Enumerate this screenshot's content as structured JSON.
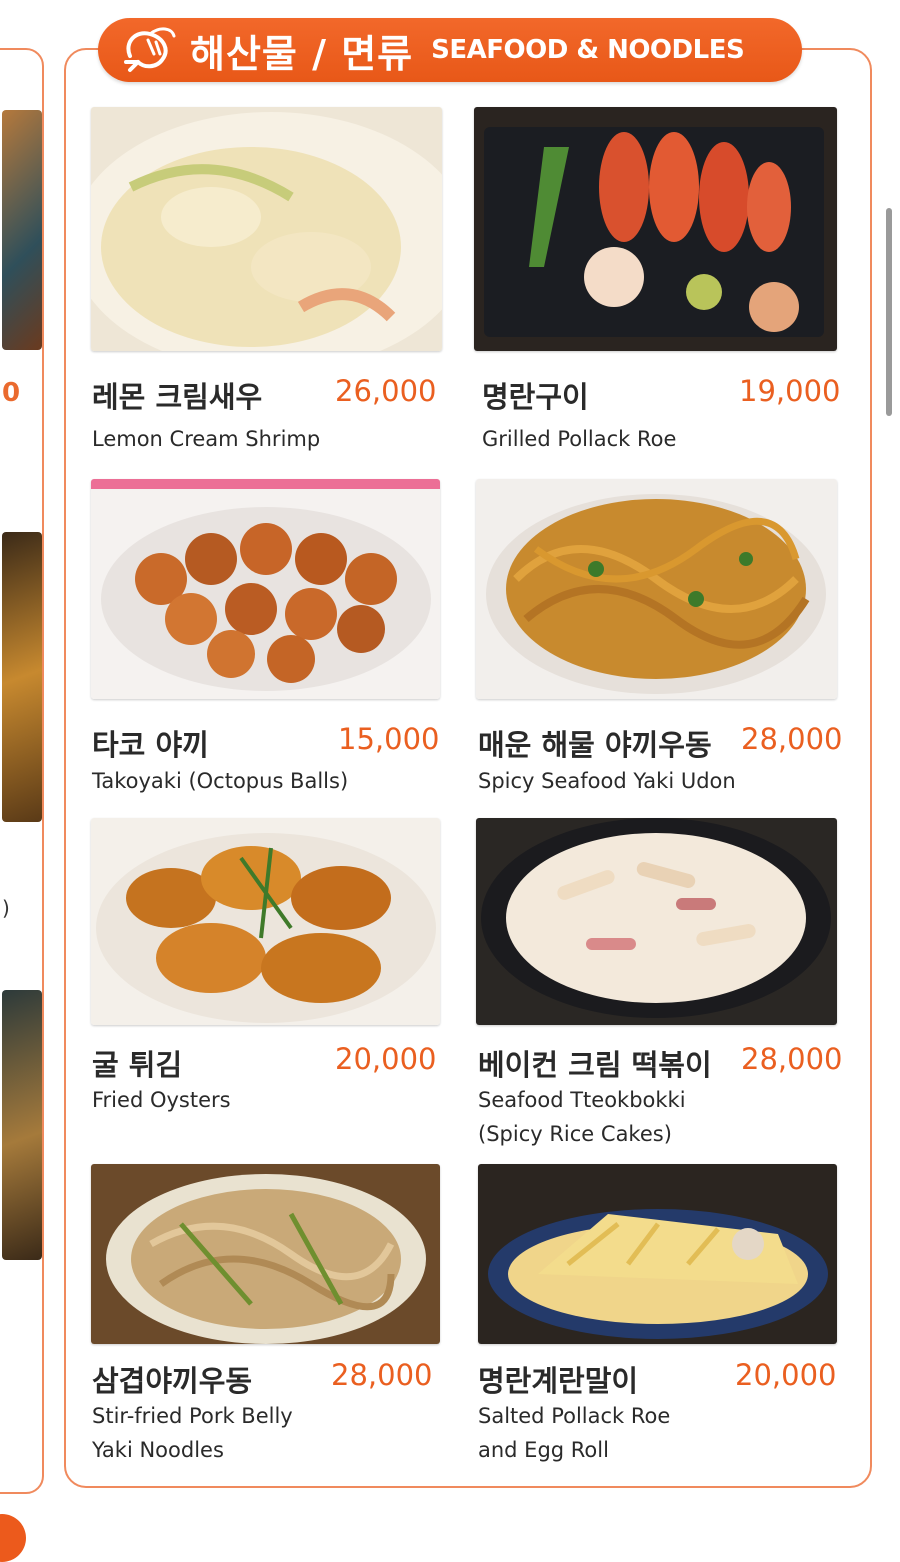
{
  "header": {
    "title_ko": "해산물 / 면류",
    "title_en": "SEAFOOD & NOODLES",
    "icon": "shrimp-icon"
  },
  "left_peek": {
    "price_fragment": "0",
    "text_fragment": ")"
  },
  "menu_items": [
    {
      "name_ko": "레몬 크림새우",
      "price": "26,000",
      "name_en": [
        "Lemon Cream Shrimp"
      ],
      "photo": "lemon-cream-shrimp-photo"
    },
    {
      "name_ko": "명란구이",
      "price": "19,000",
      "name_en": [
        "Grilled Pollack Roe"
      ],
      "photo": "grilled-pollack-roe-photo"
    },
    {
      "name_ko": "타코 야끼",
      "price": "15,000",
      "name_en": [
        "Takoyaki (Octopus Balls)"
      ],
      "photo": "takoyaki-photo"
    },
    {
      "name_ko": "매운 해물 야끼우동",
      "price": "28,000",
      "name_en": [
        "Spicy Seafood Yaki Udon"
      ],
      "photo": "spicy-seafood-udon-photo"
    },
    {
      "name_ko": "굴 튀김",
      "price": "20,000",
      "name_en": [
        "Fried Oysters"
      ],
      "photo": "fried-oysters-photo"
    },
    {
      "name_ko": "베이컨 크림 떡볶이",
      "price": "28,000",
      "name_en": [
        "Seafood Tteokbokki",
        "(Spicy Rice Cakes)"
      ],
      "photo": "bacon-cream-tteokbokki-photo"
    },
    {
      "name_ko": "삼겹야끼우동",
      "price": "28,000",
      "name_en": [
        "Stir-fried Pork Belly",
        "Yaki Noodles"
      ],
      "photo": "pork-belly-yaki-noodles-photo"
    },
    {
      "name_ko": "명란계란말이",
      "price": "20,000",
      "name_en": [
        "Salted Pollack Roe",
        "and Egg Roll"
      ],
      "photo": "pollack-roe-egg-roll-photo"
    }
  ],
  "colors": {
    "accent": "#ea5f20",
    "header": "#ec5e1e",
    "border": "#f08a5d"
  }
}
